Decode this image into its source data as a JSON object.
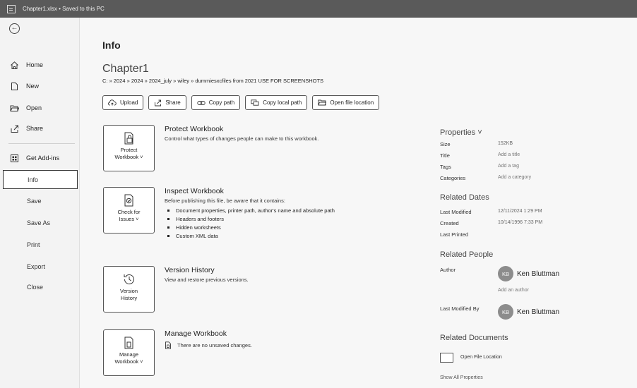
{
  "titlebar": {
    "title": "Chapter1.xlsx • Saved to this PC"
  },
  "sidebar": {
    "items": [
      {
        "label": "Home"
      },
      {
        "label": "New"
      },
      {
        "label": "Open"
      },
      {
        "label": "Share"
      },
      {
        "label": "Get Add-ins"
      },
      {
        "label": "Info"
      },
      {
        "label": "Save"
      },
      {
        "label": "Save As"
      },
      {
        "label": "Print"
      },
      {
        "label": "Export"
      },
      {
        "label": "Close"
      }
    ]
  },
  "main": {
    "heading": "Info",
    "file_title": "Chapter1",
    "file_path": "C: » 2024 » 2024 » 2024_july » wiley » dummiesxcfiles from 2021 USE FOR SCREENSHOTS",
    "actions": [
      {
        "label": "Upload"
      },
      {
        "label": "Share"
      },
      {
        "label": "Copy path"
      },
      {
        "label": "Copy local path"
      },
      {
        "label": "Open file location"
      }
    ],
    "protect": {
      "tile_label_1": "Protect",
      "tile_label_2": "Workbook ˅",
      "title": "Protect Workbook",
      "desc": "Control what types of changes people can make to this workbook."
    },
    "inspect": {
      "tile_label_1": "Check for",
      "tile_label_2": "Issues ˅",
      "title": "Inspect Workbook",
      "desc": "Before publishing this file, be aware that it contains:",
      "bullets": [
        "Document properties, printer path, author's name and absolute path",
        "Headers and footers",
        "Hidden worksheets",
        "Custom XML data"
      ]
    },
    "version": {
      "tile_label_1": "Version",
      "tile_label_2": "History",
      "title": "Version History",
      "desc": "View and restore previous versions."
    },
    "manage": {
      "tile_label_1": "Manage",
      "tile_label_2": "Workbook ˅",
      "title": "Manage Workbook",
      "desc": "There are no unsaved changes."
    }
  },
  "properties": {
    "heading": "Properties ˅",
    "size_label": "Size",
    "size_value": "152KB",
    "title_label": "Title",
    "title_value": "Add a title",
    "tags_label": "Tags",
    "tags_value": "Add a tag",
    "categories_label": "Categories",
    "categories_value": "Add a category",
    "dates_heading": "Related Dates",
    "last_modified_label": "Last Modified",
    "last_modified_value": "12/11/2024 1:29 PM",
    "created_label": "Created",
    "created_value": "10/14/1996 7:33 PM",
    "last_printed_label": "Last Printed",
    "people_heading": "Related People",
    "author_label": "Author",
    "author_initials": "KB",
    "author_name": "Ken Bluttman",
    "add_author": "Add an author",
    "last_modified_by_label": "Last Modified By",
    "modifier_initials": "KB",
    "modifier_name": "Ken Bluttman",
    "docs_heading": "Related Documents",
    "open_file_location": "Open File Location",
    "show_all": "Show All Properties"
  }
}
